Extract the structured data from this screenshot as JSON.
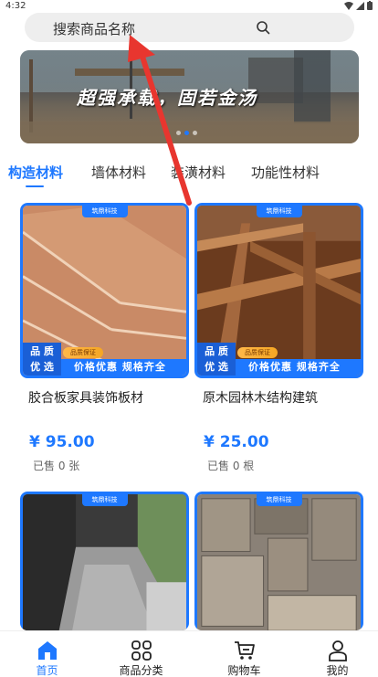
{
  "status": {
    "time": "4:32"
  },
  "search": {
    "placeholder": "搜索商品名称"
  },
  "banner": {
    "text": "超强承载，固若金汤",
    "dot_count": 3,
    "active_dot": 1
  },
  "tabs": [
    {
      "label": "构造材料",
      "active": true
    },
    {
      "label": "墙体材料",
      "active": false
    },
    {
      "label": "装潢材料",
      "active": false
    },
    {
      "label": "功能性材料",
      "active": false
    }
  ],
  "products": [
    {
      "brand": "筑鼎科技",
      "promo_left_1": "品 质",
      "promo_left_2": "优 选",
      "promo_badge": "品质保证",
      "promo_right": "价格优惠  规格齐全",
      "title": "胶合板家具装饰板材",
      "price": "¥ 95.00",
      "sold": "已售 0 张"
    },
    {
      "brand": "筑鼎科技",
      "promo_left_1": "品 质",
      "promo_left_2": "优 选",
      "promo_badge": "品质保证",
      "promo_right": "价格优惠  规格齐全",
      "title": "原木园林木结构建筑",
      "price": "¥ 25.00",
      "sold": "已售 0 根"
    },
    {
      "brand": "筑鼎科技"
    },
    {
      "brand": "筑鼎科技"
    }
  ],
  "nav": [
    {
      "label": "首页",
      "icon": "home-icon",
      "active": true
    },
    {
      "label": "商品分类",
      "icon": "grid-icon",
      "active": false
    },
    {
      "label": "购物车",
      "icon": "cart-icon",
      "active": false
    },
    {
      "label": "我的",
      "icon": "user-icon",
      "active": false
    }
  ],
  "colors": {
    "accent": "#1e78ff",
    "annotation_arrow": "#e8362f"
  }
}
